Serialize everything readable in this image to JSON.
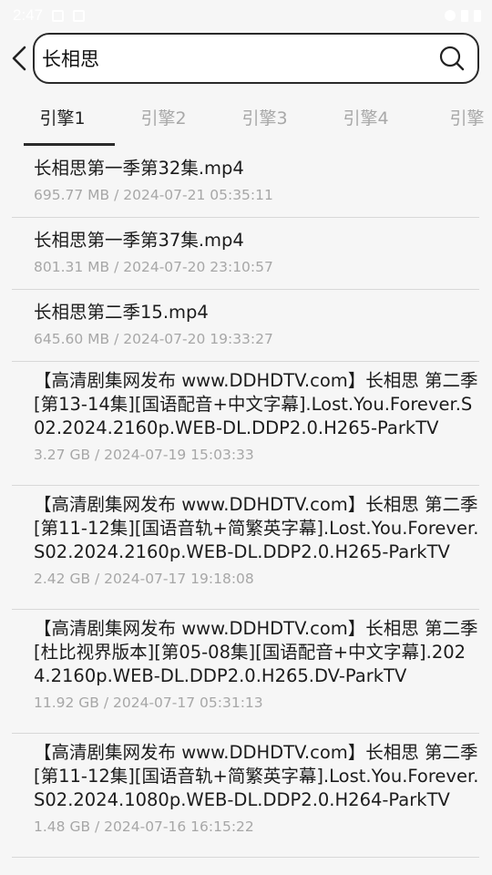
{
  "statusbar": {
    "time": "2:47"
  },
  "search": {
    "value": "长相思"
  },
  "tabs": [
    "引擎1",
    "引擎2",
    "引擎3",
    "引擎4",
    "引擎"
  ],
  "results": [
    {
      "title": "长相思第一季第32集.mp4",
      "meta": "695.77 MB / 2024-07-21 05:35:11"
    },
    {
      "title": "长相思第一季第37集.mp4",
      "meta": "801.31 MB / 2024-07-20 23:10:57"
    },
    {
      "title": "长相思第二季15.mp4",
      "meta": "645.60 MB / 2024-07-20 19:33:27"
    },
    {
      "title": "【高清剧集网发布 www.DDHDTV.com】长相思 第二季[第13-14集][国语配音+中文字幕].Lost.You.Forever.S02.2024.2160p.WEB-DL.DDP2.0.H265-ParkTV",
      "meta": "3.27 GB / 2024-07-19 15:03:33"
    },
    {
      "title": "【高清剧集网发布 www.DDHDTV.com】长相思 第二季[第11-12集][国语音轨+简繁英字幕].Lost.You.Forever.S02.2024.2160p.WEB-DL.DDP2.0.H265-ParkTV",
      "meta": "2.42 GB / 2024-07-17 19:18:08"
    },
    {
      "title": "【高清剧集网发布 www.DDHDTV.com】长相思 第二季[杜比视界版本][第05-08集][国语配音+中文字幕].2024.2160p.WEB-DL.DDP2.0.H265.DV-ParkTV",
      "meta": "11.92 GB / 2024-07-17 05:31:13"
    },
    {
      "title": "【高清剧集网发布 www.DDHDTV.com】长相思 第二季[第11-12集][国语音轨+简繁英字幕].Lost.You.Forever.S02.2024.1080p.WEB-DL.DDP2.0.H264-ParkTV",
      "meta": "1.48 GB / 2024-07-16 16:15:22"
    }
  ]
}
